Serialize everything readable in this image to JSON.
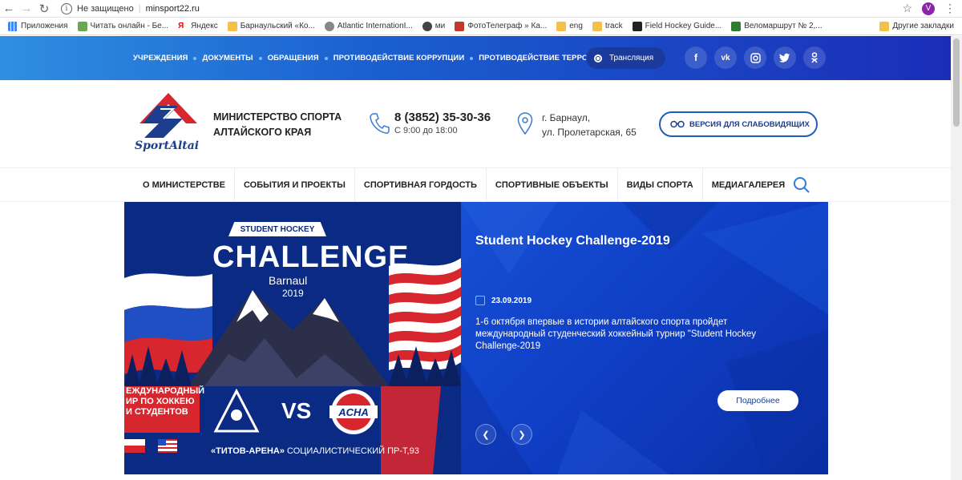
{
  "browser": {
    "security_label": "Не защищено",
    "url": "minsport22.ru",
    "profile_initial": "V",
    "bookmarks": [
      {
        "label": "Приложения",
        "color": "#4285f4"
      },
      {
        "label": "Читать онлайн - Бе...",
        "color": "#6aa84f"
      },
      {
        "label": "Яндекс",
        "color": "#ff0000"
      },
      {
        "label": "Барнаульский «Ко...",
        "color": "#f5c04a"
      },
      {
        "label": "Atlantic InternationI...",
        "color": "#888888"
      },
      {
        "label": "ми",
        "color": "#444444"
      },
      {
        "label": "ФотоТелеграф » Ка...",
        "color": "#c0392b"
      },
      {
        "label": "eng",
        "color": "#f5c04a"
      },
      {
        "label": "track",
        "color": "#f5c04a"
      },
      {
        "label": "Field Hockey Guide...",
        "color": "#222222"
      },
      {
        "label": "Веломаршрут № 2,...",
        "color": "#2e7d32"
      }
    ],
    "other_bookmarks": "Другие закладки"
  },
  "topbar": {
    "links": [
      "УЧРЕЖДЕНИЯ",
      "ДОКУМЕНТЫ",
      "ОБРАЩЕНИЯ",
      "ПРОТИВОДЕЙСТВИЕ КОРРУПЦИИ",
      "ПРОТИВОДЕЙСТВИЕ ТЕРРОРИЗМУ"
    ],
    "broadcast": "Трансляция",
    "social": [
      "f",
      "vk",
      "ig",
      "tw",
      "ok"
    ]
  },
  "header": {
    "logo_text": "SportAltai",
    "title_line1": "МИНИСТЕРСТВО СПОРТА",
    "title_line2": "АЛТАЙСКОГО КРАЯ",
    "phone": "8 (3852) 35-30-36",
    "hours": "С 9:00 до 18:00",
    "address_line1": "г. Барнаул,",
    "address_line2": "ул. Пролетарская, 65",
    "accessibility_button": "ВЕРСИЯ ДЛЯ СЛАБОВИДЯЩИХ"
  },
  "mainnav": {
    "items": [
      "О МИНИСТЕРСТВЕ",
      "СОБЫТИЯ И ПРОЕКТЫ",
      "СПОРТИВНАЯ ГОРДОСТЬ",
      "СПОРТИВНЫЕ ОБЪЕКТЫ",
      "ВИДЫ СПОРТА",
      "МЕДИАГАЛЕРЕЯ"
    ]
  },
  "slide": {
    "title": "Student Hockey Challenge-2019",
    "date": "23.09.2019",
    "text": "1-6 октября впервые в истории алтайского спорта пройдет международный студенческий хоккейный турнир \"Student Hockey Challenge-2019",
    "more_button": "Подробнее",
    "poster": {
      "head": "STUDENT HOCKEY",
      "title": "CHALLENGE",
      "city": "Barnaul",
      "year": "2019",
      "red_lines": [
        "ЕЖДУНАРОДНЫЙ",
        "ИР ПО ХОККЕЮ",
        "И СТУДЕНТОВ"
      ],
      "vs": "VS",
      "acha": "ACHA",
      "venue_bold": "«ТИТОВ-АРЕНА»",
      "venue_rest": " СОЦИАЛИСТИЧЕСКИЙ ПР-Т,93"
    }
  },
  "colors": {
    "brand_blue": "#1d3e8f",
    "brand_red": "#d7262e"
  }
}
